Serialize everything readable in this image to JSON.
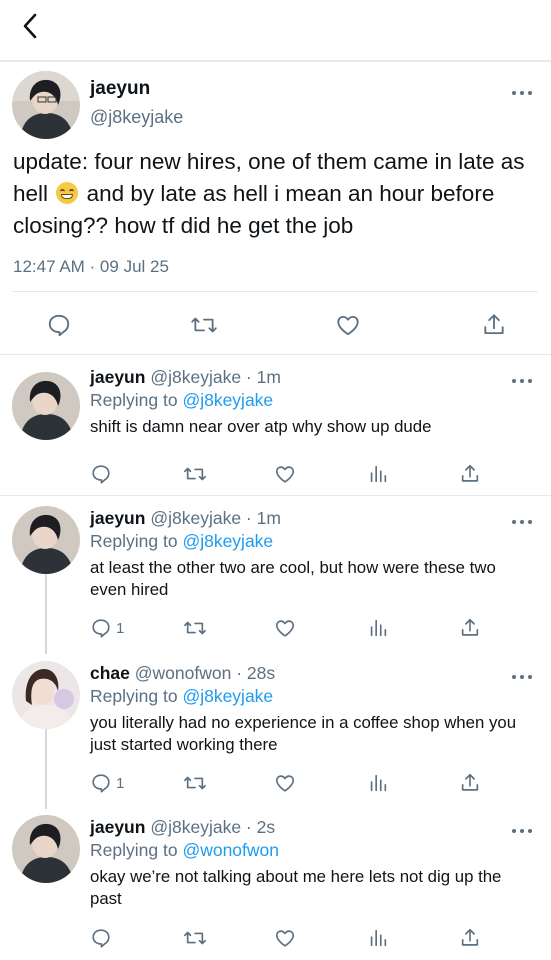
{
  "main_tweet": {
    "name": "jaeyun",
    "handle": "@j8keyjake",
    "text_part1": "update: four new hires, one of them came in late as hell",
    "emoji": "grinning-face-emoji",
    "text_part2": "and by late as hell i mean an hour before closing?? how tf did he get the job",
    "timestamp": "12:47 AM · 09 Jul 25"
  },
  "replies": [
    {
      "name": "jaeyun",
      "meta": "@j8keyjake · 1m",
      "replying_prefix": "Replying to",
      "replying_to": "@j8keyjake",
      "text": "shift is damn near over atp why show up dude",
      "reply_count": ""
    },
    {
      "name": "jaeyun",
      "meta": "@j8keyjake · 1m",
      "replying_prefix": "Replying to",
      "replying_to": "@j8keyjake",
      "text": "at least the other two are cool, but how were these two even hired",
      "reply_count": "1"
    },
    {
      "name": "chae",
      "meta": "@wonofwon · 28s",
      "replying_prefix": "Replying to",
      "replying_to": "@j8keyjake",
      "text": "you literally had no experience in a coffee shop when you just started working there",
      "reply_count": "1"
    },
    {
      "name": "jaeyun",
      "meta": "@j8keyjake · 2s",
      "replying_prefix": "Replying to",
      "replying_to": "@wonofwon",
      "text": "okay we’re not talking about me here lets not dig up the past",
      "reply_count": ""
    }
  ],
  "colors": {
    "text": "#0f1419",
    "secondary": "#5b7083",
    "link": "#1d9bf0",
    "divider": "#e6e9ec"
  }
}
